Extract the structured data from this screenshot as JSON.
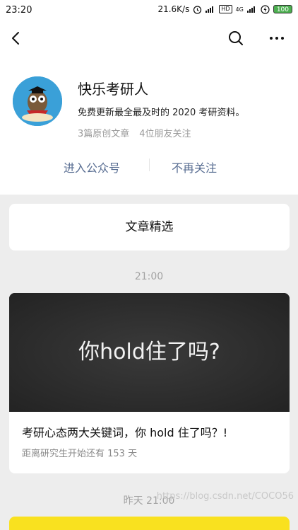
{
  "status_bar": {
    "time": "23:20",
    "net_speed": "21.6K/s",
    "network": "4G",
    "battery": "100"
  },
  "nav": {
    "back": "back-icon",
    "search": "search-icon",
    "more": "more-icon"
  },
  "profile": {
    "name": "快乐考研人",
    "description": "免费更新最全最及时的 2020 考研资料。",
    "articles": "3篇原创文章",
    "friends": "4位朋友关注",
    "enter_label": "进入公众号",
    "unfollow_label": "不再关注"
  },
  "featured": {
    "label": "文章精选"
  },
  "feed": {
    "time_1": "21:00",
    "article_1": {
      "cover_text": "你hold住了吗?",
      "title": "考研心态两大关键词，你 hold 住了吗？!",
      "subtitle": "距离研究生开始还有 153 天"
    },
    "time_2": "昨天 21:00"
  },
  "watermark": "https://blog.csdn.net/COCO56",
  "colors": {
    "link": "#586d92",
    "background": "#ededed",
    "accent_card": "#f9e11f"
  }
}
